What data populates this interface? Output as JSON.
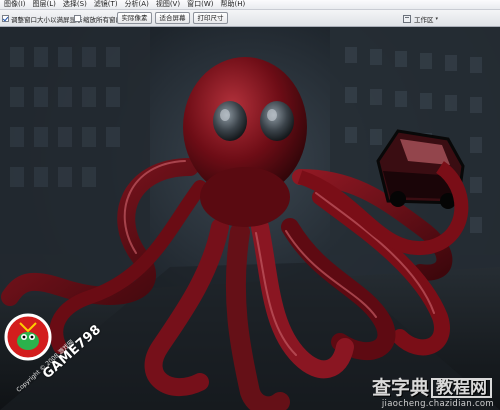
{
  "menubar": {
    "items": [
      {
        "label": "图像(I)"
      },
      {
        "label": "图层(L)"
      },
      {
        "label": "选择(S)"
      },
      {
        "label": "滤镜(T)"
      },
      {
        "label": "分析(A)"
      },
      {
        "label": "视图(V)"
      },
      {
        "label": "窗口(W)"
      },
      {
        "label": "帮助(H)"
      }
    ]
  },
  "optionsbar": {
    "resize_windows": {
      "label": "调整窗口大小以满屏显示",
      "checked": true
    },
    "zoom_all_windows": {
      "label": "缩放所有窗口",
      "checked": false
    },
    "actual_pixels_label": "实际像素",
    "fit_screen_label": "适合屏幕",
    "print_size_label": "打印尺寸",
    "workspace_label": "工作区",
    "workspace_icon": "workspace-icon",
    "workspace_caret": "▾"
  },
  "canvas": {
    "scene": "red-octopus-in-dark-city-street"
  },
  "logos": {
    "game_title": "GAME798",
    "game_copyright": "Copyright © 2008 游戏网"
  },
  "watermark": {
    "part1": "查字典",
    "part2": "教程网",
    "url": "jiaocheng.chazidian.com"
  },
  "colors": {
    "octopus": "#7a0e17",
    "octopus_highlight": "#c04a55",
    "background": "#1e252c",
    "menubar": "#eef0f3"
  }
}
